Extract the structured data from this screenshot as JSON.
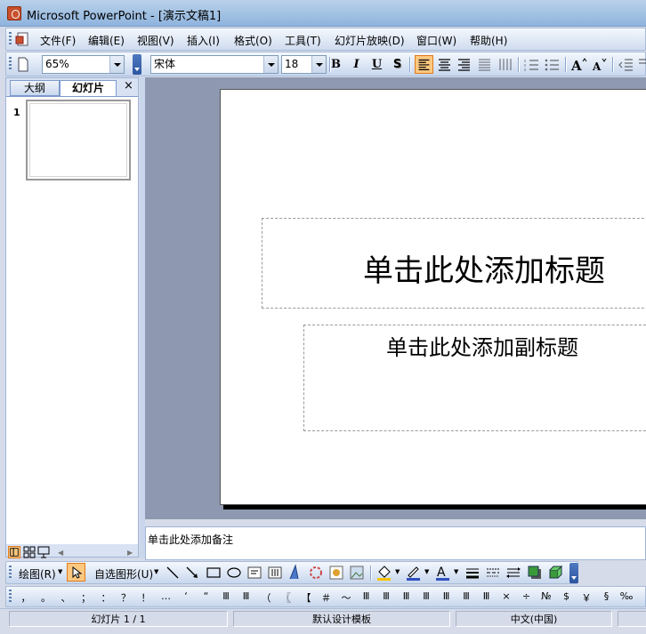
{
  "window": {
    "title": "Microsoft PowerPoint - [演示文稿1]"
  },
  "menu": {
    "items": [
      {
        "label": "文件(F)"
      },
      {
        "label": "编辑(E)"
      },
      {
        "label": "视图(V)"
      },
      {
        "label": "插入(I)"
      },
      {
        "label": "格式(O)"
      },
      {
        "label": "工具(T)"
      },
      {
        "label": "幻灯片放映(D)"
      },
      {
        "label": "窗口(W)"
      },
      {
        "label": "帮助(H)"
      }
    ]
  },
  "toolbar": {
    "zoom": "65%",
    "font_name": "宋体",
    "font_size": "18",
    "bold": "B",
    "italic": "I",
    "underline": "U",
    "shadow": "S"
  },
  "left_pane": {
    "tab_outline": "大纲",
    "tab_slides": "幻灯片",
    "close": "×",
    "slide_number": "1"
  },
  "slide": {
    "title_placeholder": "单击此处添加标题",
    "subtitle_placeholder": "单击此处添加副标题"
  },
  "notes": {
    "placeholder": "单击此处添加备注"
  },
  "drawing_toolbar": {
    "draw_label": "绘图(R)",
    "autoshapes_label": "自选图形(U)"
  },
  "symbol_toolbar": {
    "symbols": [
      "，",
      "。",
      "、",
      "；",
      "：",
      "？",
      "！",
      "…",
      "‘",
      "“",
      "Ⅲ",
      "Ⅲ",
      "（",
      "〖",
      "【",
      "＃",
      "～",
      "Ⅲ",
      "Ⅲ",
      "Ⅲ",
      "Ⅲ",
      "Ⅲ",
      "Ⅲ",
      "Ⅲ",
      "×",
      "÷",
      "№",
      "$",
      "￥",
      "§",
      "‰"
    ]
  },
  "status": {
    "slide_info": "幻灯片 1 / 1",
    "design": "默认设计模板",
    "language": "中文(中国)"
  },
  "colors": {
    "accent": "#fcc880",
    "editor_bg": "#8e99b1",
    "title_bar": "#9fbfe2"
  }
}
